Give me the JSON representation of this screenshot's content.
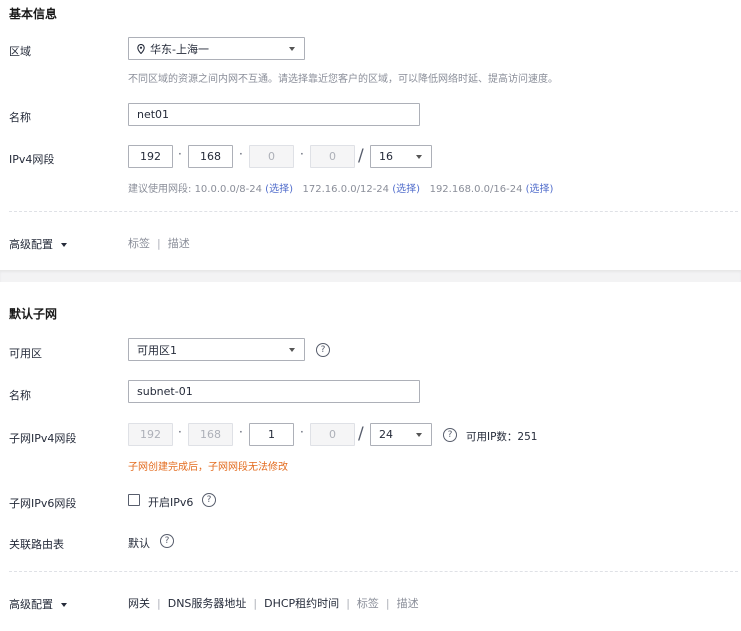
{
  "basic": {
    "section_title": "基本信息",
    "region_label": "区域",
    "region_value": "华东-上海一",
    "region_hint": "不同区域的资源之间内网不互通。请选择靠近您客户的区域，可以降低网络时延、提高访问速度。",
    "name_label": "名称",
    "name_value": "net01",
    "ipv4_label": "IPv4网段",
    "ip": [
      "192",
      "168",
      "0",
      "0"
    ],
    "mask": "16",
    "suggest_prefix": "建议使用网段:",
    "suggest": [
      {
        "range": "10.0.0.0/8-24",
        "select": "(选择)"
      },
      {
        "range": "172.16.0.0/12-24",
        "select": "(选择)"
      },
      {
        "range": "192.168.0.0/16-24",
        "select": "(选择)"
      }
    ],
    "advanced_label": "高级配置",
    "tabs": [
      "标签",
      "描述"
    ]
  },
  "subnet": {
    "section_title": "默认子网",
    "az_label": "可用区",
    "az_value": "可用区1",
    "name_label": "名称",
    "name_value": "subnet-01",
    "ipv4_label": "子网IPv4网段",
    "ip": [
      "192",
      "168",
      "1",
      "0"
    ],
    "mask": "24",
    "available_ip": "可用IP数：251",
    "warning": "子网创建完成后，子网网段无法修改",
    "ipv6_label": "子网IPv6网段",
    "ipv6_checkbox": "开启IPv6",
    "route_label": "关联路由表",
    "route_value": "默认",
    "advanced_label": "高级配置",
    "tabs": [
      "网关",
      "DNS服务器地址",
      "DHCP租约时间",
      "标签",
      "描述"
    ]
  },
  "icons": {
    "help": "?",
    "location": "location-pin-icon",
    "dropdown": "chevron-down-icon"
  },
  "colors": {
    "link": "#526ecc",
    "warning": "#e36b1e",
    "section_gap": "#f3f3f4"
  }
}
